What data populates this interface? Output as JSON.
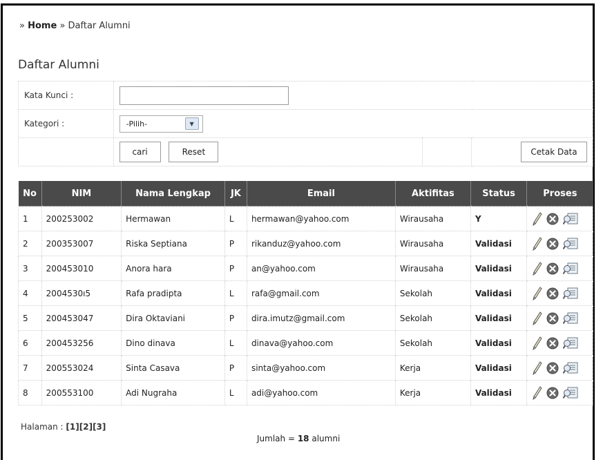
{
  "breadcrumb": {
    "prefix": "»",
    "home": "Home",
    "sep": "»",
    "current": "Daftar Alumni"
  },
  "page_title": "Daftar Alumni",
  "filter": {
    "keyword_label": "Kata Kunci :",
    "keyword_value": "",
    "category_label": "Kategori :",
    "category_selected": "-Pilih-",
    "search_label": "cari",
    "reset_label": "Reset",
    "print_label": "Cetak Data"
  },
  "table": {
    "headers": [
      "No",
      "NIM",
      "Nama Lengkap",
      "JK",
      "Email",
      "Aktifitas",
      "Status",
      "Proses"
    ],
    "rows": [
      {
        "no": "1",
        "nim": "200253002",
        "nama": "Hermawan",
        "jk": "L",
        "email": "hermawan@yahoo.com",
        "aktifitas": "Wirausaha",
        "status": "Y"
      },
      {
        "no": "2",
        "nim": "200353007",
        "nama": "Riska Septiana",
        "jk": "P",
        "email": "rikanduz@yahoo.com",
        "aktifitas": "Wirausaha",
        "status": "Validasi"
      },
      {
        "no": "3",
        "nim": "200453010",
        "nama": "Anora hara",
        "jk": "P",
        "email": "an@yahoo.com",
        "aktifitas": "Wirausaha",
        "status": "Validasi"
      },
      {
        "no": "4",
        "nim": "2004530ı5",
        "nama": "Rafa pradipta",
        "jk": "L",
        "email": "rafa@gmail.com",
        "aktifitas": "Sekolah",
        "status": "Validasi"
      },
      {
        "no": "5",
        "nim": "200453047",
        "nama": "Dira Oktaviani",
        "jk": "P",
        "email": "dira.imutz@gmail.com",
        "aktifitas": "Sekolah",
        "status": "Validasi"
      },
      {
        "no": "6",
        "nim": "200453256",
        "nama": "Dino dinava",
        "jk": "L",
        "email": "dinava@yahoo.com",
        "aktifitas": "Sekolah",
        "status": "Validasi"
      },
      {
        "no": "7",
        "nim": "200553024",
        "nama": "Sinta Casava",
        "jk": "P",
        "email": "sinta@yahoo.com",
        "aktifitas": "Kerja",
        "status": "Validasi"
      },
      {
        "no": "8",
        "nim": "200553100",
        "nama": "Adi Nugraha",
        "jk": "L",
        "email": "adi@yahoo.com",
        "aktifitas": "Kerja",
        "status": "Validasi"
      }
    ],
    "action_icons": [
      "pencil-icon",
      "delete-icon",
      "detail-icon"
    ]
  },
  "pagination": {
    "label": "Halaman :",
    "pages": [
      "[1]",
      "[2]",
      "[3]"
    ]
  },
  "total": {
    "prefix": "Jumlah =",
    "count": "18",
    "suffix": "alumni"
  }
}
